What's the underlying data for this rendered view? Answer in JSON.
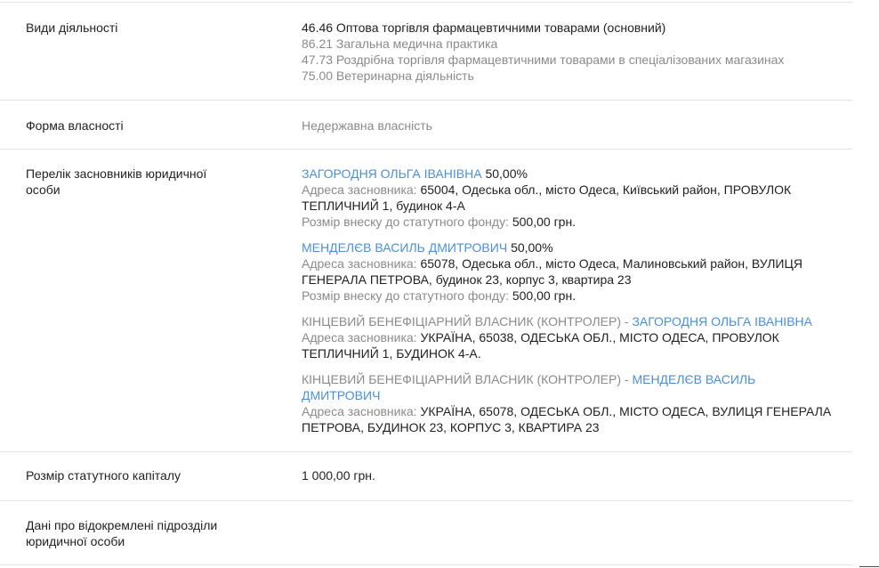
{
  "activities": {
    "label": "Види діяльності",
    "items": [
      "46.46 Оптова торгівля фармацевтичними товарами (основний)",
      "86.21 Загальна медична практика",
      "47.73 Роздрібна торгівля фармацевтичними товарами в спеціалізованих магазинах",
      "75.00 Ветеринарна діяльність"
    ]
  },
  "ownership": {
    "label": "Форма власності",
    "value": "Недержавна власність"
  },
  "founders": {
    "label": "Перелік засновників юридичної особи",
    "address_label": "Адреса засновника:",
    "contribution_label": "Розмір внеску до статутного фонду:",
    "items": [
      {
        "name": "ЗАГОРОДНЯ ОЛЬГА ІВАНІВНА",
        "share": "50,00%",
        "address_line1": "65004, Одеська обл., місто Одеса, Київський район, ПРОВУЛОК",
        "address_line2": "ТЕПЛИЧНИЙ 1, будинок 4-А",
        "contribution": "500,00 грн."
      },
      {
        "name": "МЕНДЕЛЄВ ВАСИЛЬ ДМИТРОВИЧ",
        "share": "50,00%",
        "address_line1": "65078, Одеська обл., місто Одеса, Малиновський район, ВУЛИЦЯ",
        "address_line2": "ГЕНЕРАЛА ПЕТРОВА, будинок 23, корпус 3, квартира 23",
        "contribution": "500,00 грн."
      }
    ],
    "beneficiaries": [
      {
        "prefix": "КІНЦЕВИЙ БЕНЕФІЦІАРНИЙ ВЛАСНИК (КОНТРОЛЕР) - ",
        "name": "ЗАГОРОДНЯ ОЛЬГА ІВАНІВНА",
        "address_line1": "УКРАЇНА, 65038, ОДЕСЬКА ОБЛ., МІСТО ОДЕСА, ПРОВУЛОК",
        "address_line2": "ТЕПЛИЧНИЙ 1, БУДИНОК 4-А."
      },
      {
        "prefix": "КІНЦЕВИЙ БЕНЕФІЦІАРНИЙ ВЛАСНИК (КОНТРОЛЕР) - ",
        "name_part1": "МЕНДЕЛЄВ ВАСИЛЬ",
        "name_part2": "ДМИТРОВИЧ",
        "address_line1": "УКРАЇНА, 65078, ОДЕСЬКА ОБЛ., МІСТО ОДЕСА, ВУЛИЦЯ ГЕНЕРАЛА",
        "address_line2": "ПЕТРОВА, БУДИНОК 23, КОРПУС 3, КВАРТИРА 23"
      }
    ]
  },
  "capital": {
    "label": "Розмір статутного капіталу",
    "value": "1 000,00 грн."
  },
  "subdivisions": {
    "label": "Дані про відокремлені підрозділи юридичної особи"
  },
  "colors": {
    "link": "#4a90d9",
    "muted": "#8a8a8a",
    "text": "#212121",
    "divider": "#e3e3e3"
  }
}
